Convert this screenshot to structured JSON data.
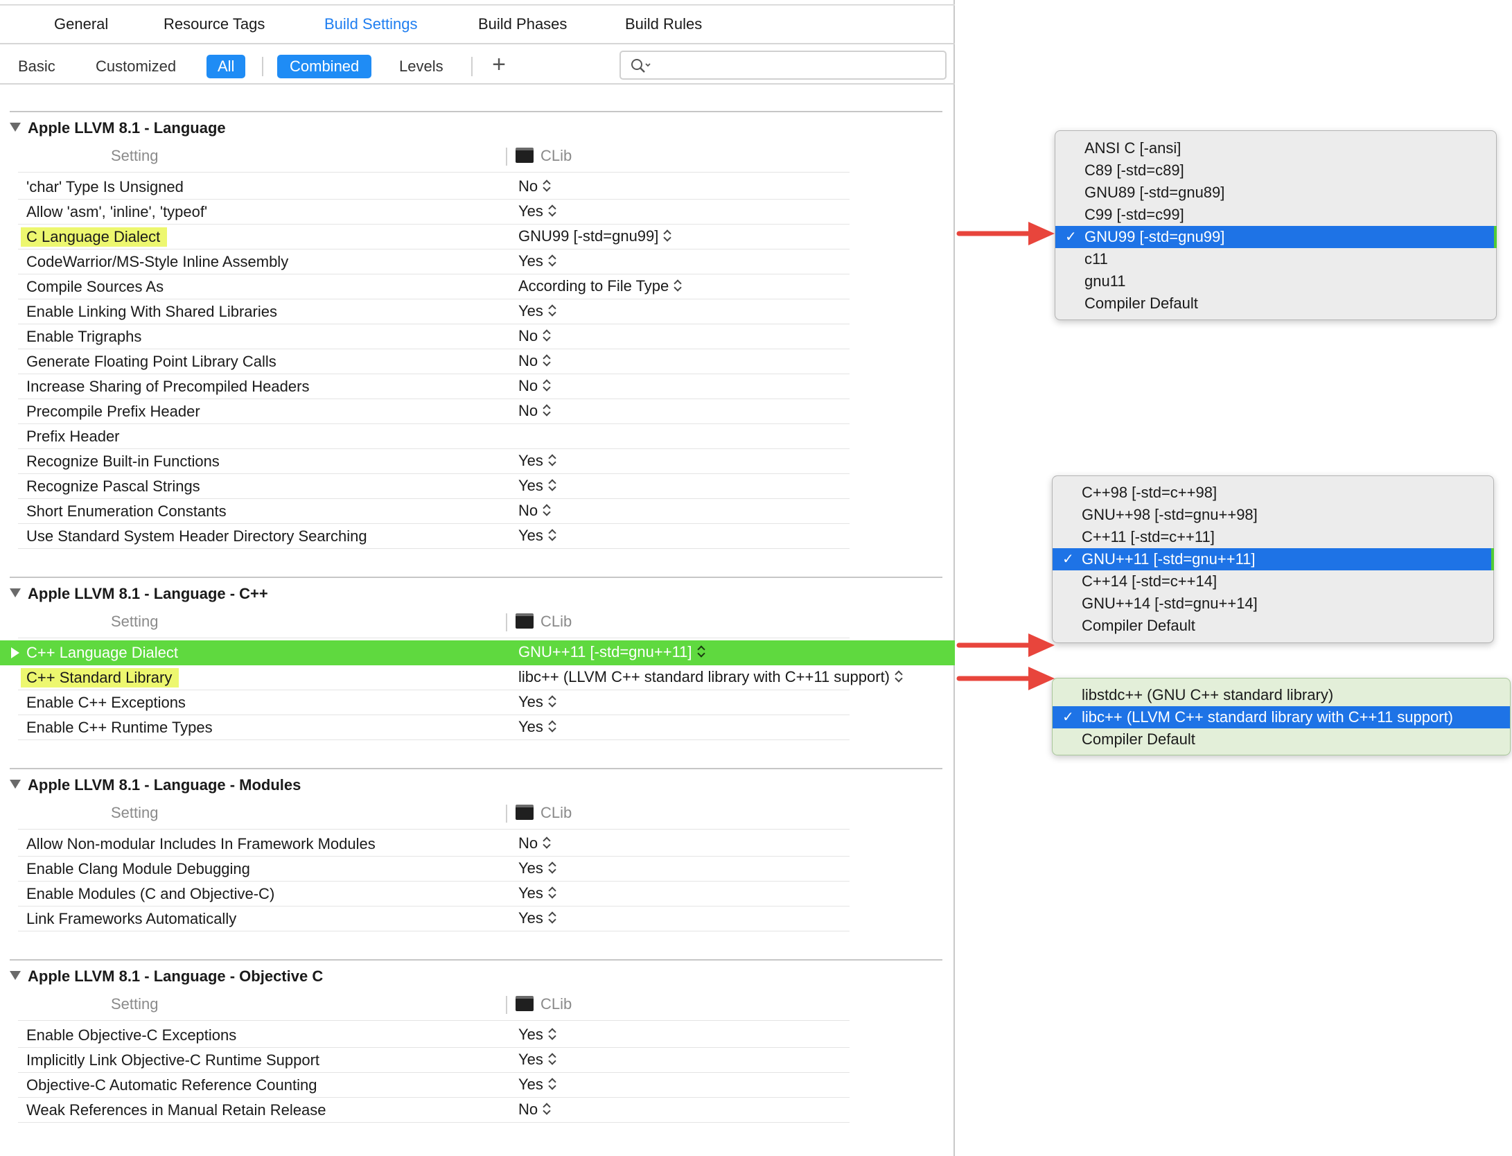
{
  "tabs": [
    {
      "label": "General",
      "active": false
    },
    {
      "label": "Resource Tags",
      "active": false
    },
    {
      "label": "Build Settings",
      "active": true
    },
    {
      "label": "Build Phases",
      "active": false
    },
    {
      "label": "Build Rules",
      "active": false
    }
  ],
  "filters": {
    "basic": "Basic",
    "customized": "Customized",
    "all": "All",
    "combined": "Combined",
    "levels": "Levels",
    "add": "+",
    "search_placeholder": ""
  },
  "sections": [
    {
      "title": "Apple LLVM 8.1 - Language",
      "setting_header": "Setting",
      "target_header": "CLib",
      "rows": [
        {
          "name": "'char' Type Is Unsigned",
          "value": "No"
        },
        {
          "name": "Allow 'asm', 'inline', 'typeof'",
          "value": "Yes"
        },
        {
          "name": "C Language Dialect",
          "value": "GNU99 [-std=gnu99]",
          "highlight": true
        },
        {
          "name": "CodeWarrior/MS-Style Inline Assembly",
          "value": "Yes"
        },
        {
          "name": "Compile Sources As",
          "value": "According to File Type"
        },
        {
          "name": "Enable Linking With Shared Libraries",
          "value": "Yes"
        },
        {
          "name": "Enable Trigraphs",
          "value": "No"
        },
        {
          "name": "Generate Floating Point Library Calls",
          "value": "No"
        },
        {
          "name": "Increase Sharing of Precompiled Headers",
          "value": "No"
        },
        {
          "name": "Precompile Prefix Header",
          "value": "No"
        },
        {
          "name": "Prefix Header",
          "value": ""
        },
        {
          "name": "Recognize Built-in Functions",
          "value": "Yes"
        },
        {
          "name": "Recognize Pascal Strings",
          "value": "Yes"
        },
        {
          "name": "Short Enumeration Constants",
          "value": "No"
        },
        {
          "name": "Use Standard System Header Directory Searching",
          "value": "Yes"
        }
      ]
    },
    {
      "title": "Apple LLVM 8.1 - Language - C++",
      "setting_header": "Setting",
      "target_header": "CLib",
      "rows": [
        {
          "name": "C++ Language Dialect",
          "value": "GNU++11 [-std=gnu++11]",
          "selected": true
        },
        {
          "name": "C++ Standard Library",
          "value": "libc++ (LLVM C++ standard library with C++11 support)",
          "highlight": true
        },
        {
          "name": "Enable C++ Exceptions",
          "value": "Yes"
        },
        {
          "name": "Enable C++ Runtime Types",
          "value": "Yes"
        }
      ]
    },
    {
      "title": "Apple LLVM 8.1 - Language - Modules",
      "setting_header": "Setting",
      "target_header": "CLib",
      "rows": [
        {
          "name": "Allow Non-modular Includes In Framework Modules",
          "value": "No"
        },
        {
          "name": "Enable Clang Module Debugging",
          "value": "Yes"
        },
        {
          "name": "Enable Modules (C and Objective-C)",
          "value": "Yes"
        },
        {
          "name": "Link Frameworks Automatically",
          "value": "Yes"
        }
      ]
    },
    {
      "title": "Apple LLVM 8.1 - Language - Objective C",
      "setting_header": "Setting",
      "target_header": "CLib",
      "rows": [
        {
          "name": "Enable Objective-C Exceptions",
          "value": "Yes"
        },
        {
          "name": "Implicitly Link Objective-C Runtime Support",
          "value": "Yes"
        },
        {
          "name": "Objective-C Automatic Reference Counting",
          "value": "Yes"
        },
        {
          "name": "Weak References in Manual Retain Release",
          "value": "No"
        }
      ]
    }
  ],
  "popups": {
    "c_dialect": {
      "items": [
        "ANSI C [-ansi]",
        "C89 [-std=c89]",
        "GNU89 [-std=gnu89]",
        "C99 [-std=c99]",
        "GNU99 [-std=gnu99]",
        "c11",
        "gnu11",
        "Compiler Default"
      ],
      "selected_index": 4
    },
    "cpp_dialect": {
      "items": [
        "C++98 [-std=c++98]",
        "GNU++98 [-std=gnu++98]",
        "C++11 [-std=c++11]",
        "GNU++11 [-std=gnu++11]",
        "C++14 [-std=c++14]",
        "GNU++14 [-std=gnu++14]",
        "Compiler Default"
      ],
      "selected_index": 3
    },
    "cpp_stdlib": {
      "items": [
        "libstdc++ (GNU C++ standard library)",
        "libc++ (LLVM C++ standard library with C++11 support)",
        "Compiler Default"
      ],
      "selected_index": 1
    },
    "check_mark": "✓"
  },
  "colors": {
    "accent_blue": "#1f8cf5",
    "menu_selection": "#1e73e6",
    "row_selection_green": "#5fd93f",
    "highlight_yellow": "#edf76f",
    "arrow_red": "#e8453c"
  }
}
